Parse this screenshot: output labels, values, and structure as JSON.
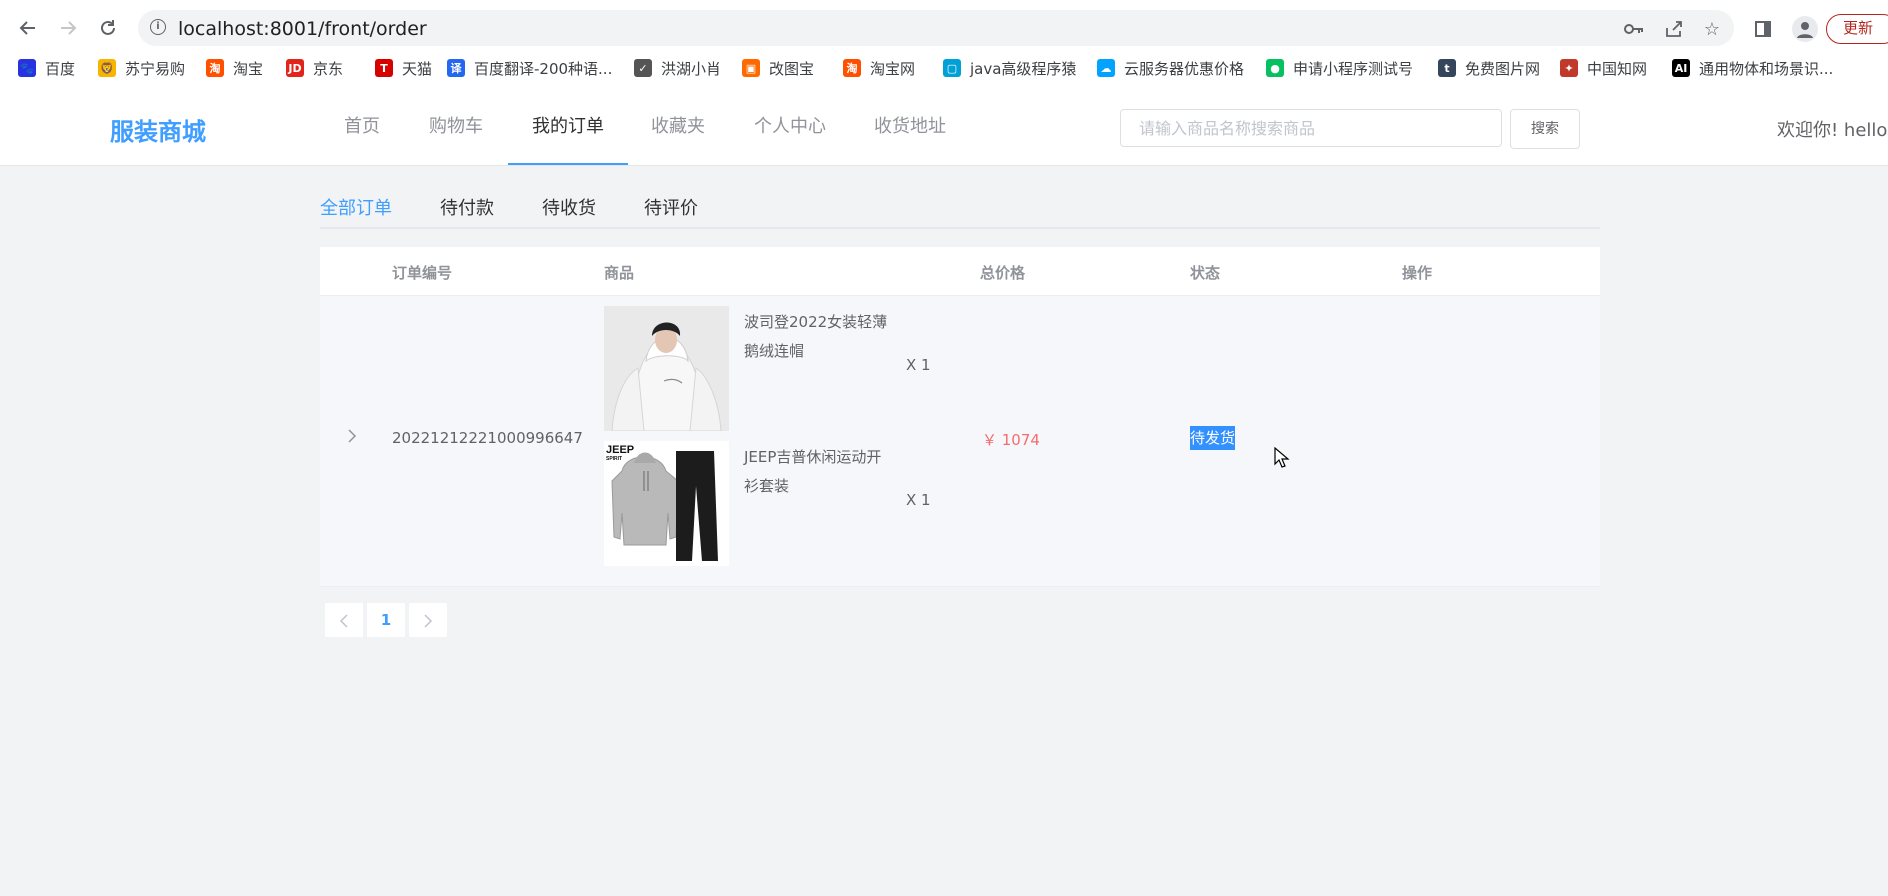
{
  "browser": {
    "url": "localhost:8001/front/order",
    "update_label": "更新",
    "bookmarks": [
      {
        "label": "百度",
        "icon": "baidu-paw-icon",
        "color": "#2932e1"
      },
      {
        "label": "苏宁易购",
        "icon": "suning-lion-icon",
        "color": "#f7b500"
      },
      {
        "label": "淘宝",
        "icon": "taobao-icon",
        "color": "#ff5000"
      },
      {
        "label": "京东",
        "icon": "jd-icon",
        "color": "#e1251b"
      },
      {
        "label": "天猫",
        "icon": "tmall-icon",
        "color": "#d60000"
      },
      {
        "label": "百度翻译-200种语...",
        "icon": "translate-icon",
        "color": "#2468f2"
      },
      {
        "label": "洪湖小肖",
        "icon": "bird-icon",
        "color": "#555555"
      },
      {
        "label": "改图宝",
        "icon": "gaitubao-icon",
        "color": "#ff6a00"
      },
      {
        "label": "淘宝网",
        "icon": "taobao-icon",
        "color": "#ff5000"
      },
      {
        "label": "java高级程序猿",
        "icon": "bilibili-icon",
        "color": "#00a1d6"
      },
      {
        "label": "云服务器优惠价格",
        "icon": "cloud-icon",
        "color": "#00a3ff"
      },
      {
        "label": "申请小程序测试号",
        "icon": "wechat-icon",
        "color": "#07c160"
      },
      {
        "label": "免费图片网",
        "icon": "tumblr-icon",
        "color": "#35465c"
      },
      {
        "label": "中国知网",
        "icon": "cnki-icon",
        "color": "#c0392b"
      },
      {
        "label": "通用物体和场景识...",
        "icon": "ai-icon",
        "color": "#000000"
      }
    ]
  },
  "site": {
    "logo": "服装商城",
    "nav": [
      "首页",
      "购物车",
      "我的订单",
      "收藏夹",
      "个人中心",
      "收货地址"
    ],
    "active_nav": "我的订单",
    "search_placeholder": "请输入商品名称搜索商品",
    "search_button": "搜索",
    "welcome": "欢迎你!  hello"
  },
  "tabs": [
    "全部订单",
    "待付款",
    "待收货",
    "待评价"
  ],
  "table": {
    "headers": [
      "订单编号",
      "商品",
      "总价格",
      "状态",
      "操作"
    ],
    "rows": [
      {
        "order_no": "20221212221000996647",
        "items": [
          {
            "name": "波司登2022女装轻薄鹅绒连帽",
            "qty": "X 1",
            "image": "white-hoodie-photo"
          },
          {
            "name": "JEEP吉普休闲运动开衫套装",
            "qty": "X 1",
            "image": "grey-tracksuit-photo"
          }
        ],
        "price": "￥ 1074",
        "status": "待发货",
        "action": ""
      }
    ]
  },
  "pagination": {
    "current": "1",
    "prev": "<",
    "next": ">"
  },
  "colors": {
    "accent": "#409eff",
    "price": "#f56c6c",
    "status_highlight": "#3390ff"
  }
}
